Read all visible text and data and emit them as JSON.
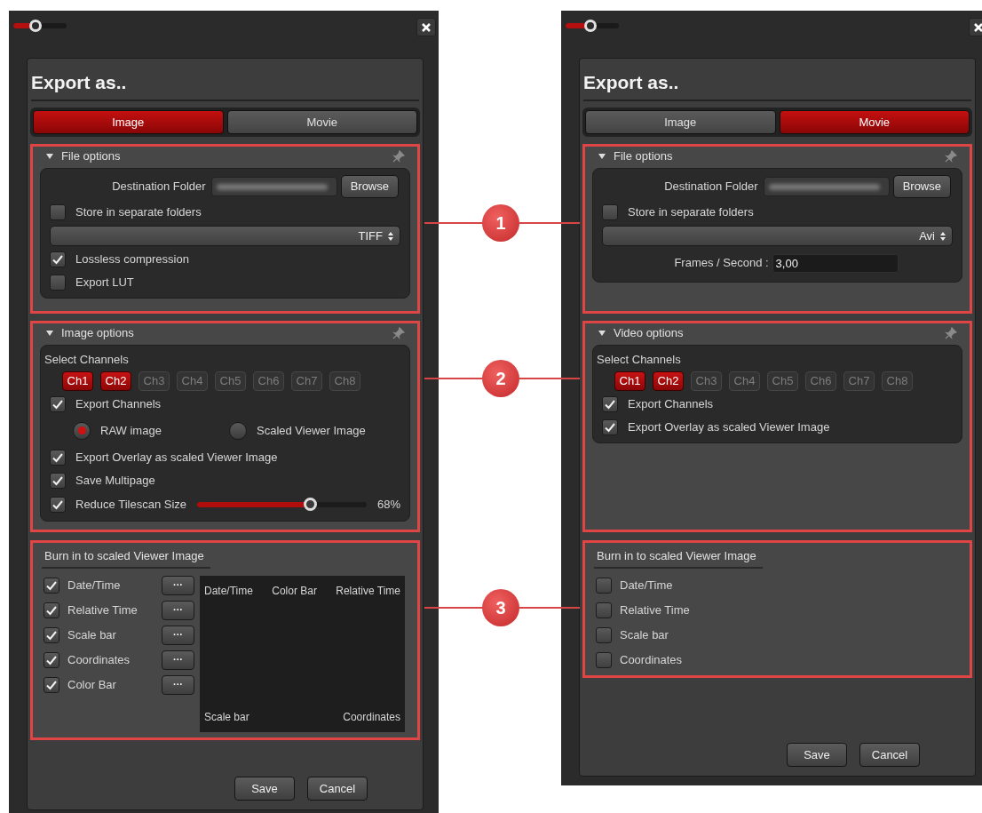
{
  "dialogs": [
    {
      "zoom": {
        "level": 0.4
      },
      "title": "Export as..",
      "tabs": [
        {
          "label": "Image",
          "selected": true
        },
        {
          "label": "Movie",
          "selected": false
        }
      ],
      "sections": [
        {
          "kind": "options",
          "title": "File options",
          "expanded": true,
          "items": [
            {
              "kind": "folder",
              "label": "Destination Folder",
              "button": "Browse"
            },
            {
              "kind": "checkbox",
              "label": "Store in separate folders",
              "checked": false
            },
            {
              "kind": "select",
              "value": "TIFF"
            },
            {
              "kind": "checkbox",
              "label": "Lossless compression",
              "checked": true
            },
            {
              "kind": "checkbox",
              "label": "Export LUT",
              "checked": false
            }
          ]
        },
        {
          "kind": "options",
          "title": "Image options",
          "expanded": true,
          "items": [
            {
              "kind": "channels",
              "label": "Select Channels",
              "channels": [
                {
                  "label": "Ch1",
                  "selected": true
                },
                {
                  "label": "Ch2",
                  "selected": true
                },
                {
                  "label": "Ch3",
                  "selected": false
                },
                {
                  "label": "Ch4",
                  "selected": false
                },
                {
                  "label": "Ch5",
                  "selected": false
                },
                {
                  "label": "Ch6",
                  "selected": false
                },
                {
                  "label": "Ch7",
                  "selected": false
                },
                {
                  "label": "Ch8",
                  "selected": false
                }
              ]
            },
            {
              "kind": "checkbox",
              "label": "Export Channels",
              "checked": true
            },
            {
              "kind": "radio",
              "options": [
                {
                  "label": "RAW image",
                  "selected": true
                },
                {
                  "label": "Scaled Viewer Image",
                  "selected": false
                }
              ]
            },
            {
              "kind": "checkbox",
              "label": "Export Overlay as scaled Viewer Image",
              "checked": true
            },
            {
              "kind": "checkbox",
              "label": "Save Multipage",
              "checked": true
            },
            {
              "kind": "slider",
              "label": "Reduce Tilescan Size",
              "checked": true,
              "level": 0.68,
              "reading": "68%"
            }
          ]
        },
        {
          "kind": "burn",
          "title": "Burn in to scaled Viewer Image",
          "options": [
            {
              "label": "Date/Time",
              "checked": true,
              "button": "···"
            },
            {
              "label": "Relative Time",
              "checked": true,
              "button": "···"
            },
            {
              "label": "Scale bar",
              "checked": true,
              "button": "···"
            },
            {
              "label": "Coordinates",
              "checked": true,
              "button": "···"
            },
            {
              "label": "Color Bar",
              "checked": true,
              "button": "···"
            }
          ],
          "preview": {
            "top": [
              "Date/Time",
              "Color Bar",
              "Relative Time"
            ],
            "bottom": [
              "Scale bar",
              "Coordinates"
            ]
          }
        }
      ],
      "buttons": [
        "Save",
        "Cancel"
      ]
    },
    {
      "zoom": {
        "level": 0.45
      },
      "title": "Export as..",
      "tabs": [
        {
          "label": "Image",
          "selected": false
        },
        {
          "label": "Movie",
          "selected": true
        }
      ],
      "sections": [
        {
          "kind": "options",
          "title": "File options",
          "expanded": true,
          "items": [
            {
              "kind": "folder",
              "label": "Destination Folder",
              "button": "Browse"
            },
            {
              "kind": "checkbox",
              "label": "Store in separate folders",
              "checked": false
            },
            {
              "kind": "select",
              "value": "Avi"
            },
            {
              "kind": "number",
              "label": "Frames / Second :",
              "value": "3,00"
            }
          ]
        },
        {
          "kind": "options",
          "title": "Video options",
          "expanded": true,
          "items": [
            {
              "kind": "channels",
              "label": "Select Channels",
              "channels": [
                {
                  "label": "Ch1",
                  "selected": true
                },
                {
                  "label": "Ch2",
                  "selected": true
                },
                {
                  "label": "Ch3",
                  "selected": false
                },
                {
                  "label": "Ch4",
                  "selected": false
                },
                {
                  "label": "Ch5",
                  "selected": false
                },
                {
                  "label": "Ch6",
                  "selected": false
                },
                {
                  "label": "Ch7",
                  "selected": false
                },
                {
                  "label": "Ch8",
                  "selected": false
                }
              ]
            },
            {
              "kind": "checkbox",
              "label": "Export Channels",
              "checked": true
            },
            {
              "kind": "checkbox",
              "label": "Export Overlay as scaled Viewer Image",
              "checked": true
            }
          ]
        },
        {
          "kind": "burn",
          "title": "Burn in to scaled Viewer Image",
          "options": [
            {
              "label": "Date/Time",
              "checked": false
            },
            {
              "label": "Relative Time",
              "checked": false
            },
            {
              "label": "Scale bar",
              "checked": false
            },
            {
              "label": "Coordinates",
              "checked": false
            }
          ]
        }
      ],
      "buttons": [
        "Save",
        "Cancel"
      ]
    }
  ],
  "callouts": [
    "1",
    "2",
    "3"
  ]
}
